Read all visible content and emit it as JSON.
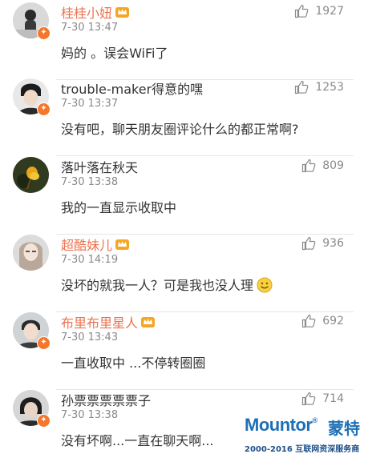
{
  "comments": [
    {
      "name": "桂桂小妞",
      "vip": true,
      "verified": true,
      "time": "7-30 13:47",
      "text": "妈的 。误会WiFi了",
      "likes": "1927",
      "emoji": false
    },
    {
      "name": "trouble-maker得意的嘿",
      "vip": false,
      "verified": true,
      "time": "7-30 13:37",
      "text": "没有吧，聊天朋友圈评论什么的都正常啊?",
      "likes": "1253",
      "emoji": false
    },
    {
      "name": "落叶落在秋天",
      "vip": false,
      "verified": false,
      "time": "7-30 13:38",
      "text": "我的一直显示收取中",
      "likes": "809",
      "emoji": false
    },
    {
      "name": "超酷妹儿",
      "vip": true,
      "verified": false,
      "time": "7-30 14:19",
      "text": "没坏的就我一人？可是我也没人理",
      "likes": "936",
      "emoji": true
    },
    {
      "name": "布里布里星人",
      "vip": true,
      "verified": true,
      "time": "7-30 13:43",
      "text": "一直收取中 ...不停转圈圈",
      "likes": "692",
      "emoji": false
    },
    {
      "name": "孙票票票票票子",
      "vip": false,
      "verified": true,
      "time": "7-30 13:38",
      "text": "没有坏啊...一直在聊天啊...",
      "likes": "714",
      "emoji": false
    }
  ],
  "watermark": {
    "brand": "Mountor",
    "reg": "®",
    "brand_cn": "蒙特",
    "tagline": "2000-2016  互联网资深服务商"
  },
  "colors": {
    "vip_name": "#eb7350",
    "meta": "#8a8a8a",
    "badge": "#f4772b",
    "brand": "#1f6fb5"
  }
}
